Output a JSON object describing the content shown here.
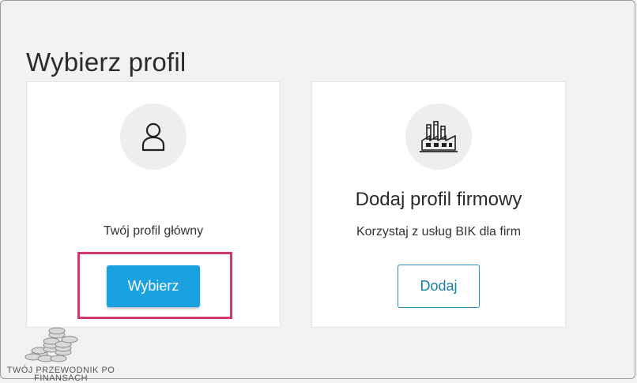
{
  "page": {
    "title": "Wybierz profil"
  },
  "cards": {
    "personal": {
      "icon": "user-icon",
      "description": "Twój profil główny",
      "button_label": "Wybierz",
      "button_color": "#1aa1e0",
      "highlight_color": "#d2386c"
    },
    "company": {
      "icon": "factory-icon",
      "heading": "Dodaj profil firmowy",
      "description": "Korzystaj z usług BIK dla firm",
      "button_label": "Dodaj",
      "button_color": "#2a8fba"
    }
  },
  "watermark": {
    "line1": "TWÓJ PRZEWODNIK PO",
    "line2": "FINANSACH"
  }
}
